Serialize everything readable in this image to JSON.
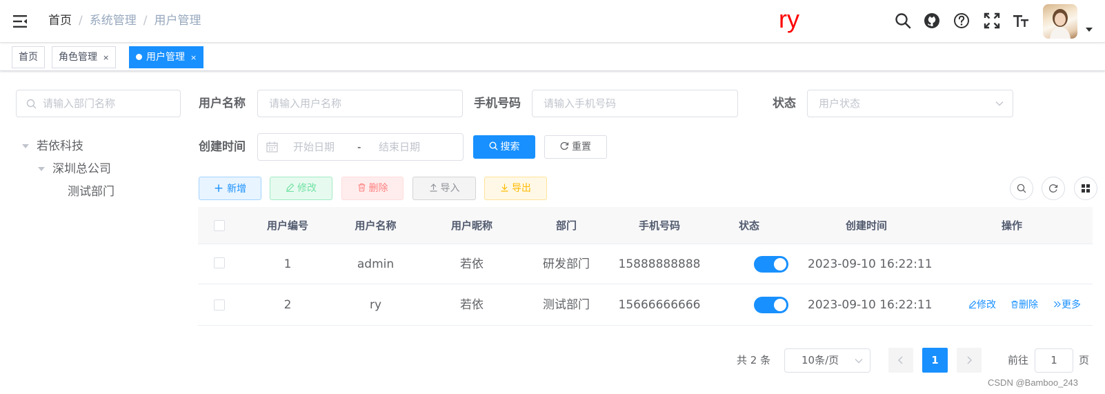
{
  "navbar": {
    "breadcrumb": [
      "首页",
      "系统管理",
      "用户管理"
    ],
    "brand_text": "ry",
    "icons": [
      "hamburger-icon",
      "search-icon",
      "github-icon",
      "help-icon",
      "fullscreen-icon",
      "font-size-icon"
    ]
  },
  "tags": [
    {
      "label": "首页",
      "active": false
    },
    {
      "label": "角色管理",
      "active": false,
      "close": "×"
    },
    {
      "label": "用户管理",
      "active": true,
      "close": "×"
    }
  ],
  "tree": {
    "search_placeholder": "请输入部门名称",
    "nodes": [
      "若依科技",
      "深圳总公司",
      "测试部门"
    ]
  },
  "filters": {
    "username_label": "用户名称",
    "username_placeholder": "请输入用户名称",
    "phone_label": "手机号码",
    "phone_placeholder": "请输入手机号码",
    "status_label": "状态",
    "status_placeholder": "用户状态",
    "created_label": "创建时间",
    "start_placeholder": "开始日期",
    "range_sep": "-",
    "end_placeholder": "结束日期",
    "search_button": "搜索",
    "reset_button": "重置"
  },
  "toolbar": {
    "add": "新增",
    "edit": "修改",
    "delete": "删除",
    "import": "导入",
    "export": "导出"
  },
  "table": {
    "headers": [
      "用户编号",
      "用户名称",
      "用户昵称",
      "部门",
      "手机号码",
      "状态",
      "创建时间",
      "操作"
    ],
    "rows": [
      {
        "id": "1",
        "username": "admin",
        "nickname": "若依",
        "dept": "研发部门",
        "phone": "15888888888",
        "status_on": true,
        "created": "2023-09-10 16:22:11",
        "actions": []
      },
      {
        "id": "2",
        "username": "ry",
        "nickname": "若依",
        "dept": "测试部门",
        "phone": "15666666666",
        "status_on": true,
        "created": "2023-09-10 16:22:11",
        "actions": [
          "修改",
          "删除",
          "更多"
        ]
      }
    ]
  },
  "pagination": {
    "total_text": "共 2 条",
    "page_size": "10条/页",
    "current_page": "1",
    "goto_label": "前往",
    "goto_value": "1",
    "page_suffix": "页"
  },
  "watermark": "CSDN @Bamboo_243",
  "colors": {
    "primary": "#1890ff",
    "brand": "#ff0000",
    "success": "#13ce66",
    "danger": "#ff4949",
    "warning": "#ffba00",
    "info": "#909399"
  }
}
